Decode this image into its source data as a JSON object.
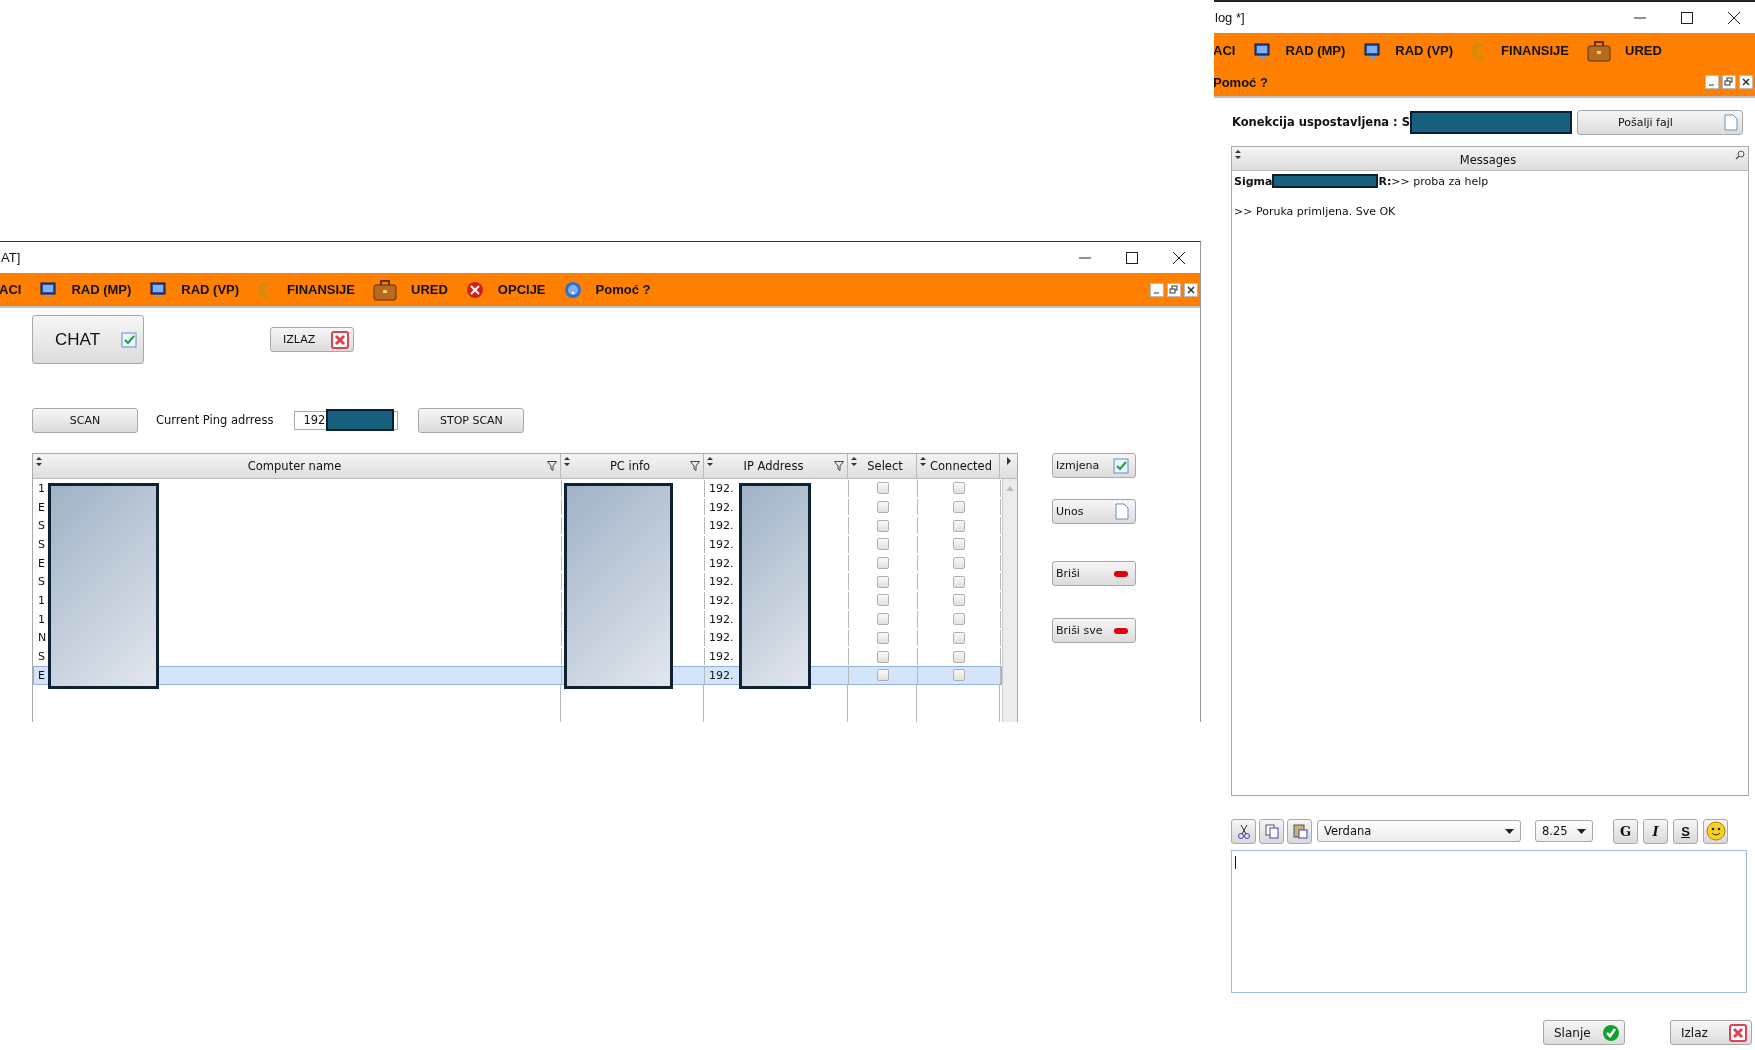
{
  "left_window": {
    "title": "AT]",
    "menu": [
      "ACI",
      "RAD (MP)",
      "RAD (VP)",
      "FINANSIJE",
      "URED",
      "OPCIJE",
      "Pomoć ?"
    ],
    "chat_button": "CHAT",
    "exit_button": "IZLAZ",
    "scan_button": "SCAN",
    "ping_label": "Current Ping adrress",
    "ping_value": "192",
    "stop_button": "STOP SCAN",
    "table": {
      "columns": [
        {
          "label": "Computer name",
          "filterable": true
        },
        {
          "label": "PC info",
          "filterable": true
        },
        {
          "label": "IP Address",
          "filterable": true
        },
        {
          "label": "Select",
          "filterable": false
        },
        {
          "label": "Connected",
          "filterable": false
        }
      ],
      "rows": [
        {
          "name": "1",
          "ip": "192.",
          "select": false,
          "connected": false,
          "selected": false
        },
        {
          "name": "E",
          "ip": "192.",
          "select": false,
          "connected": false,
          "selected": false
        },
        {
          "name": "S",
          "ip": "192.",
          "select": false,
          "connected": false,
          "selected": false
        },
        {
          "name": "S",
          "ip": "192.",
          "select": false,
          "connected": false,
          "selected": false
        },
        {
          "name": "E",
          "ip": "192.",
          "select": false,
          "connected": false,
          "selected": false
        },
        {
          "name": "S",
          "ip": "192.",
          "select": false,
          "connected": false,
          "selected": false
        },
        {
          "name": "1",
          "ip": "192.",
          "select": false,
          "connected": false,
          "selected": false
        },
        {
          "name": "1",
          "ip": "192.",
          "select": false,
          "connected": false,
          "selected": false
        },
        {
          "name": "N",
          "ip": "192.",
          "select": false,
          "connected": false,
          "selected": false
        },
        {
          "name": "S",
          "ip": "192.",
          "select": false,
          "connected": false,
          "selected": false
        },
        {
          "name": "E",
          "ip": "192.",
          "select": false,
          "connected": false,
          "selected": true
        }
      ]
    },
    "side_buttons": [
      "Izmjena",
      "Unos",
      "Briši",
      "Briši sve"
    ]
  },
  "right_window": {
    "title": "log *]",
    "menu": [
      "ACI",
      "RAD (MP)",
      "RAD (VP)",
      "FINANSIJE",
      "URED",
      "Pomoć ?"
    ],
    "connection_label": "Konekcija uspostavljena : S",
    "send_file_button": "Pošalji fajl",
    "messages_header": "Messages",
    "messages": [
      {
        "kind": "chat",
        "sender": "Sigma",
        "text": "**R:**>> proba za help"
      },
      {
        "kind": "system",
        "text": ">> Poruka primljena. Sve OK"
      }
    ],
    "font": "Verdana",
    "font_size": "8.25",
    "format_buttons": [
      "G",
      "I",
      "S"
    ],
    "send_button": "Slanje",
    "exit_button": "Izlaz"
  }
}
